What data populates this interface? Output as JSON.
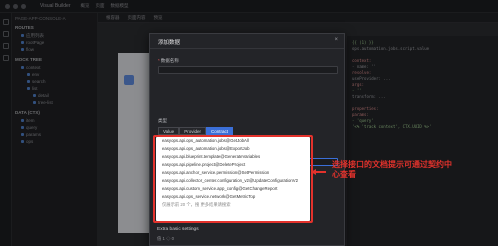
{
  "app": {
    "title": "Visual Builder",
    "tabs": [
      "概览",
      "页面",
      "数据模型"
    ]
  },
  "sidebar": {
    "header": "PAGE-APP-CONSOLE-A",
    "routes_title": "ROUTES",
    "route_items": [
      "应用列表",
      "rootPage",
      "flow",
      "..."
    ],
    "mock_title": "MOCK TREE",
    "mock_items": [
      "context",
      "env",
      "search",
      "list",
      "detail",
      "tree-list"
    ],
    "data_title": "DATA (CTX)",
    "data_items": [
      "item",
      "query",
      "params",
      "ops"
    ]
  },
  "canvas": {
    "tabs": [
      "根容器",
      "页面内容",
      "预览"
    ]
  },
  "codepanel": {
    "lines": [
      "{{ (1) }}",
      "ops.automation.jobs.script.value",
      "",
      "context:",
      "  - name: ''",
      "    resolve:",
      "      useProvider: ...",
      "      args:",
      "        - ''",
      "      transform: ...",
      "",
      "properties:",
      "  params:",
      "    - 'query'",
      "  '<% 'track context', CTX.UUID %>'"
    ]
  },
  "modal": {
    "title": "添加数据",
    "close_icon": "×",
    "name_label": "数据名称",
    "type_label": "类型",
    "type_options": [
      "Value",
      "Provider",
      "Contract"
    ],
    "type_selected": "Contract",
    "contract_label": "Contract",
    "extra_label": "Extra basic settings",
    "extra_sub": "值 1    ◇ 0"
  },
  "dropdown": {
    "items": [
      "easyops.api.ops_automation.jobs@GetJobAll",
      "easyops.api.ops_automation.jobs@ExportJob",
      "easyops.api.blueprint.template@GenerateVariables",
      "easyops.api.pipeline.project@DeleteProject",
      "easyops.api.anchor_service.permission@SetPermission",
      "easyops.api.collector_center.configuration_v2@UpdateConfigurationV2",
      "easyops.api.custom_service.app_config@GetChangeReport",
      "easyops.api.ops_service.network@GetMetricTop"
    ],
    "footer": "仅展示前 20 个，搜 更多结果请搜索"
  },
  "annotation": {
    "text": "选择接口的文档提示可通过契约中心查看"
  },
  "colors": {
    "accent": "#3b6fd8",
    "highlight": "#e3322c"
  }
}
